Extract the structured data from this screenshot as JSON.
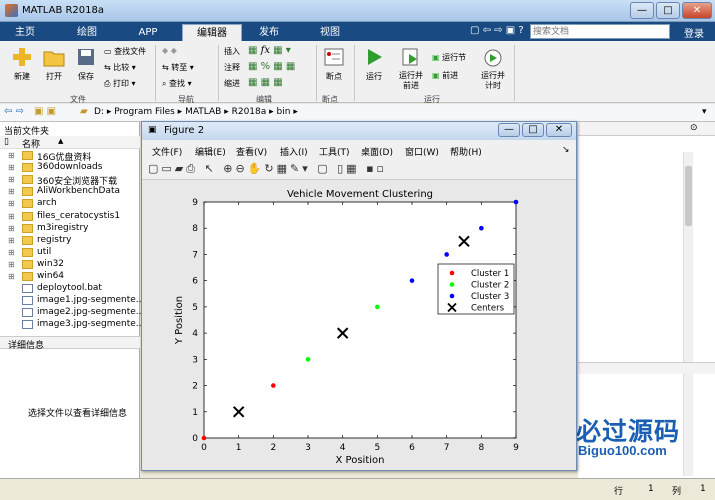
{
  "window": {
    "title": "MATLAB R2018a",
    "minimize": "—",
    "maximize": "□",
    "close": "✕"
  },
  "tabs": [
    {
      "label": "主页"
    },
    {
      "label": "绘图"
    },
    {
      "label": "APP"
    },
    {
      "label": "编辑器"
    },
    {
      "label": "发布"
    },
    {
      "label": "视图"
    }
  ],
  "search": {
    "placeholder": "搜索文档",
    "login": "登录"
  },
  "ribbon": {
    "file": {
      "new": "新建",
      "open": "打开",
      "save": "保存",
      "find_files": "查找文件",
      "compare": "比较",
      "print": "打印",
      "group": "文件"
    },
    "nav": {
      "goto": "转至",
      "find": "查找",
      "group": "导航"
    },
    "edit": {
      "insert": "插入",
      "comment": "注释",
      "indent": "缩进",
      "fx": "fx",
      "group": "编辑"
    },
    "breakpoints": {
      "label": "断点",
      "group": "断点"
    },
    "run": {
      "run": "运行",
      "run_advance": "运行并前进",
      "run_section": "运行节",
      "advance": "前进",
      "run_time": "运行并计时",
      "group": "运行"
    }
  },
  "address": {
    "path": [
      "D:",
      "Program Files",
      "MATLAB",
      "R2018a",
      "bin"
    ]
  },
  "current_folder": {
    "title": "当前文件夹",
    "column": "名称",
    "items": [
      {
        "name": "16G优盘资料",
        "type": "folder"
      },
      {
        "name": "360downloads",
        "type": "folder"
      },
      {
        "name": "360安全浏览器下载",
        "type": "folder"
      },
      {
        "name": "AliWorkbenchData",
        "type": "folder"
      },
      {
        "name": "arch",
        "type": "folder"
      },
      {
        "name": "files_ceratocystis1",
        "type": "folder"
      },
      {
        "name": "m3iregistry",
        "type": "folder"
      },
      {
        "name": "registry",
        "type": "folder"
      },
      {
        "name": "util",
        "type": "folder"
      },
      {
        "name": "win32",
        "type": "folder"
      },
      {
        "name": "win64",
        "type": "folder"
      },
      {
        "name": "deploytool.bat",
        "type": "file"
      },
      {
        "name": "image1.jpg-segmente...",
        "type": "file"
      },
      {
        "name": "image2.jpg-segmente...",
        "type": "file"
      },
      {
        "name": "image3.jpg-segmente...",
        "type": "file"
      }
    ]
  },
  "details": {
    "title": "详细信息",
    "hint": "选择文件以查看详细信息"
  },
  "status": {
    "row_label": "行",
    "row": "1",
    "col_label": "列",
    "col": "1"
  },
  "watermark": {
    "brand": "必过源码",
    "url": "Biguo100.com"
  },
  "figure": {
    "title": "Figure 2",
    "menu": [
      "文件(F)",
      "编辑(E)",
      "查看(V)",
      "插入(I)",
      "工具(T)",
      "桌面(D)",
      "窗口(W)",
      "帮助(H)"
    ]
  },
  "chart_data": {
    "type": "scatter",
    "title": "Vehicle Movement Clustering",
    "xlabel": "X Position",
    "ylabel": "Y Position",
    "xlim": [
      0,
      9
    ],
    "ylim": [
      0,
      9
    ],
    "xticks": [
      0,
      1,
      2,
      3,
      4,
      5,
      6,
      7,
      8,
      9
    ],
    "yticks": [
      0,
      1,
      2,
      3,
      4,
      5,
      6,
      7,
      8,
      9
    ],
    "grid": false,
    "legend_position": "right",
    "series": [
      {
        "name": "Cluster 1",
        "color": "#ff0000",
        "marker": "dot",
        "points": [
          [
            0,
            0
          ],
          [
            2,
            2
          ]
        ]
      },
      {
        "name": "Cluster 2",
        "color": "#00ff00",
        "marker": "dot",
        "points": [
          [
            3,
            3
          ],
          [
            5,
            5
          ]
        ]
      },
      {
        "name": "Cluster 3",
        "color": "#0000ff",
        "marker": "dot",
        "points": [
          [
            6,
            6
          ],
          [
            7,
            7
          ],
          [
            8,
            8
          ],
          [
            9,
            9
          ]
        ]
      },
      {
        "name": "Centers",
        "color": "#000000",
        "marker": "x",
        "points": [
          [
            1,
            1
          ],
          [
            4,
            4
          ],
          [
            7.5,
            7.5
          ]
        ]
      }
    ]
  }
}
